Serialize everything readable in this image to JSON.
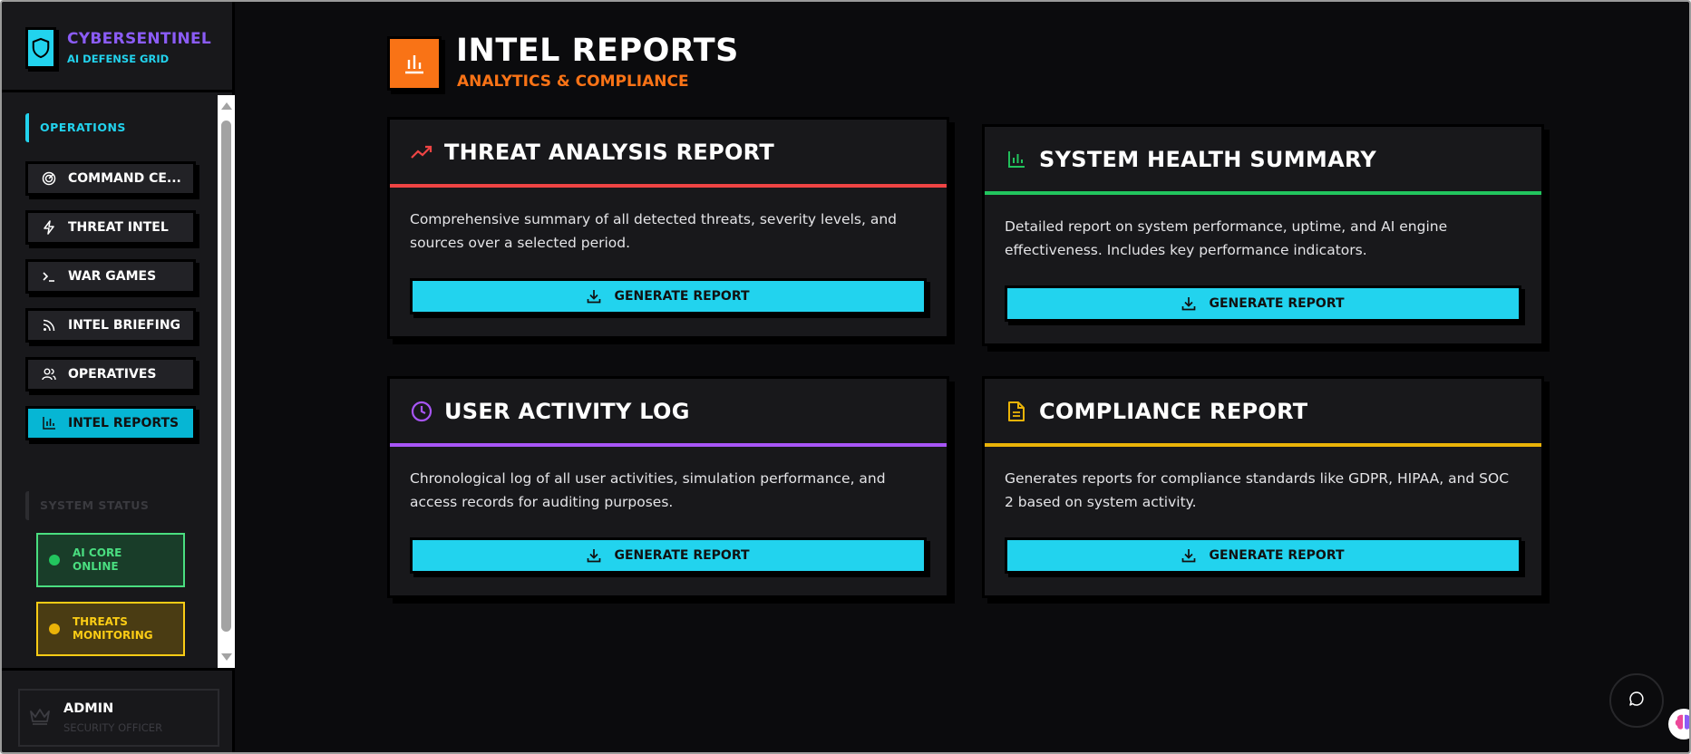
{
  "brand": {
    "name": "CYBERSENTINEL",
    "tagline": "AI DEFENSE GRID"
  },
  "sidebar": {
    "operations_title": "OPERATIONS",
    "items": [
      {
        "label": "COMMAND CE...",
        "icon": "radar-icon"
      },
      {
        "label": "THREAT INTEL",
        "icon": "lightning-icon"
      },
      {
        "label": "WAR GAMES",
        "icon": "terminal-icon"
      },
      {
        "label": "INTEL BRIEFING",
        "icon": "rss-icon"
      },
      {
        "label": "OPERATIVES",
        "icon": "users-icon"
      },
      {
        "label": "INTEL REPORTS",
        "icon": "bar-chart-icon",
        "active": true
      }
    ],
    "status_title": "SYSTEM STATUS",
    "status": [
      {
        "line1": "AI CORE",
        "line2": "ONLINE",
        "color": "#4ade80"
      },
      {
        "line1": "THREATS",
        "line2": "MONITORING",
        "color": "#facc15"
      }
    ]
  },
  "user": {
    "name": "ADMIN",
    "role": "SECURITY OFFICER"
  },
  "header": {
    "title": "INTEL REPORTS",
    "subtitle": "ANALYTICS & COMPLIANCE",
    "accent": "#f97316"
  },
  "cards": [
    {
      "title": "THREAT ANALYSIS REPORT",
      "description": "Comprehensive summary of all detected threats, severity levels, and sources over a selected period.",
      "button": "GENERATE REPORT",
      "icon": "trending-up-icon",
      "color": "#ef4444"
    },
    {
      "title": "SYSTEM HEALTH SUMMARY",
      "description": "Detailed report on system performance, uptime, and AI engine effectiveness. Includes key performance indicators.",
      "button": "GENERATE REPORT",
      "icon": "bar-chart-icon",
      "color": "#22c55e"
    },
    {
      "title": "USER ACTIVITY LOG",
      "description": "Chronological log of all user activities, simulation performance, and access records for auditing purposes.",
      "button": "GENERATE REPORT",
      "icon": "clock-icon",
      "color": "#a855f7"
    },
    {
      "title": "COMPLIANCE REPORT",
      "description": "Generates reports for compliance standards like GDPR, HIPAA, and SOC 2 based on system activity.",
      "button": "GENERATE REPORT",
      "icon": "document-icon",
      "color": "#eab308"
    }
  ]
}
